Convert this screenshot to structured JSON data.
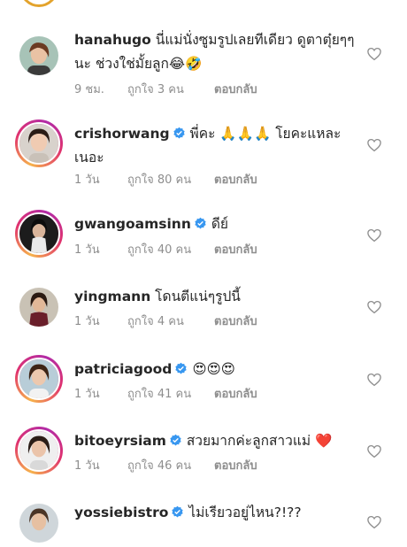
{
  "comments": [
    {
      "username": "hanahugo",
      "verified": false,
      "text": "นี่แม่นั่งซูมรูปเลยทีเดียว ดูตาตุ๋ยๆๆนะ ช่วงใช่มั้ยลูก😂🤣",
      "time": "9 ชม.",
      "likes": "ถูกใจ 3 คน",
      "reply": "ตอบกลับ",
      "story_ring": false
    },
    {
      "username": "crishorwang",
      "verified": true,
      "text": "พี่คะ 🙏🙏🙏 โยคะแหละเนอะ",
      "time": "1 วัน",
      "likes": "ถูกใจ 80 คน",
      "reply": "ตอบกลับ",
      "story_ring": true
    },
    {
      "username": "gwangoamsinn",
      "verified": true,
      "text": "ดีย์",
      "time": "1 วัน",
      "likes": "ถูกใจ 40 คน",
      "reply": "ตอบกลับ",
      "story_ring": true
    },
    {
      "username": "yingmann",
      "verified": false,
      "text": "โดนตีแน่ๆรูปนี้",
      "time": "1 วัน",
      "likes": "ถูกใจ 4 คน",
      "reply": "ตอบกลับ",
      "story_ring": false
    },
    {
      "username": "patriciagood",
      "verified": true,
      "text": "😍😍😍",
      "time": "1 วัน",
      "likes": "ถูกใจ 41 คน",
      "reply": "ตอบกลับ",
      "story_ring": true
    },
    {
      "username": "bitoeyrsiam",
      "verified": true,
      "text": "สวยมากค่ะลูกสาวแม่ ❤️",
      "time": "1 วัน",
      "likes": "ถูกใจ 46 คน",
      "reply": "ตอบกลับ",
      "story_ring": true
    },
    {
      "username": "yossiebistro",
      "verified": true,
      "text": "ไม่เรียวอยู่ไหน?!??",
      "story_ring": false
    }
  ],
  "colors": {
    "verified_badge": "#3897f0",
    "meta_text": "#8e8e8e",
    "story_ring_start": "#f6b24b",
    "story_ring_end": "#b12ba7"
  },
  "icons": {
    "like": "heart-outline-icon",
    "verified": "verified-badge-icon"
  }
}
